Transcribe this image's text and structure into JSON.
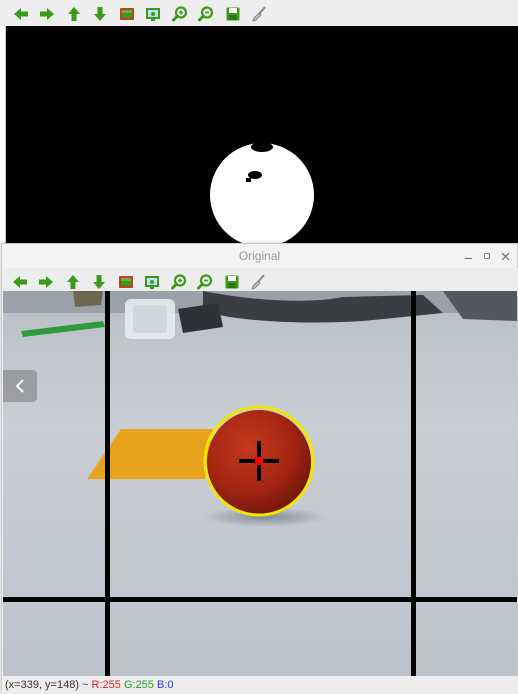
{
  "mask_window": {
    "toolbar": [
      {
        "icon": "arrow-left-icon",
        "color": "#3a9a1a"
      },
      {
        "icon": "arrow-right-icon",
        "color": "#3a9a1a"
      },
      {
        "icon": "arrow-up-icon",
        "color": "#3a9a1a"
      },
      {
        "icon": "arrow-down-icon",
        "color": "#3a9a1a"
      },
      {
        "icon": "image-icon",
        "color": "#c04020"
      },
      {
        "icon": "properties-icon",
        "color": "#3a9a1a"
      },
      {
        "icon": "zoom-in-icon",
        "color": "#3a9a1a"
      },
      {
        "icon": "zoom-out-icon",
        "color": "#3a9a1a"
      },
      {
        "icon": "save-icon",
        "color": "#3a9a1a"
      },
      {
        "icon": "brush-icon",
        "color": "#888888"
      }
    ]
  },
  "original_window": {
    "title": "Original",
    "controls": [
      "minimize",
      "maximize",
      "close"
    ],
    "status": {
      "coords": "(x=339, y=148) ~ ",
      "r": "R:255",
      "g": "G:255",
      "b": "B:0"
    }
  },
  "colors": {
    "accent_green": "#3a9a1a",
    "ball_red": "#a82410",
    "contour_yellow": "#f0e600",
    "grid_black": "#000000",
    "floor": "#c4c9d0",
    "tape_orange": "#e8a31c"
  }
}
